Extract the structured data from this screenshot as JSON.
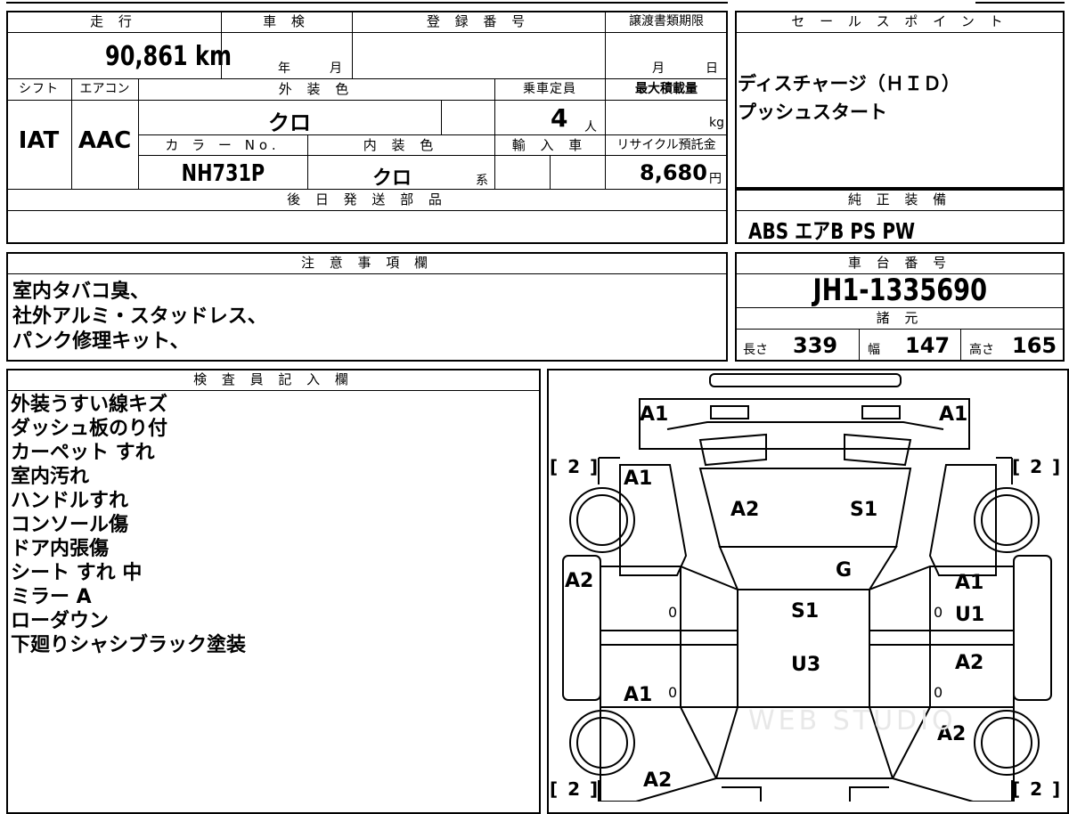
{
  "main_table": {
    "mileage_header": "走 行",
    "inspection_header": "車 検",
    "registration_header": "登 録 番 号",
    "transfer_header": "譲渡書類期限",
    "mileage_value": "90,861",
    "mileage_unit": "km",
    "inspection_year_unit": "年",
    "inspection_month_unit": "月",
    "transfer_month_unit": "月",
    "transfer_day_unit": "日",
    "shift_header": "シフト",
    "aircon_header": "エアコン",
    "exterior_color_header": "外 装 色",
    "capacity_header": "乗車定員",
    "max_load_header": "最大積載量",
    "shift_value": "IAT",
    "aircon_value": "AAC",
    "exterior_color_value": "クロ",
    "capacity_value": "4",
    "capacity_unit": "人",
    "max_load_unit": "kg",
    "color_no_header": "カ ラ ー No.",
    "interior_color_header": "内 装 色",
    "import_header": "輸 入 車",
    "recycle_header": "リサイクル預託金",
    "color_no_value": "NH731P",
    "interior_color_value": "クロ",
    "interior_color_suffix": "系",
    "recycle_value": "8,680",
    "recycle_unit": "円",
    "later_parts_header": "後 日 発 送 部 品"
  },
  "sales_points": {
    "header": "セ ー ル ス ポ イ ン ト",
    "lines": [
      "ディスチャージ（ＨＩＤ）",
      "プッシュスタート"
    ]
  },
  "standard_equipment": {
    "header": "純 正 装 備",
    "value": "ABS エアB PS PW"
  },
  "notes": {
    "header": "注 意 事 項 欄",
    "lines": [
      "室内タバコ臭、",
      "社外アルミ・スタッドレス、",
      "パンク修理キット、"
    ]
  },
  "chassis": {
    "header": "車 台 番 号",
    "value": "JH1-1335690",
    "specs_header": "諸 元",
    "length_label": "長さ",
    "length_value": "339",
    "width_label": "幅",
    "width_value": "147",
    "height_label": "高さ",
    "height_value": "165"
  },
  "inspector": {
    "header": "検 査 員 記 入 欄",
    "lines": [
      "外装うすい線キズ",
      "ダッシュ板のり付",
      "カーペット すれ",
      "室内汚れ",
      "ハンドルすれ",
      "コンソール傷",
      "ドア内張傷",
      "シート すれ 中",
      "ミラー A",
      "ローダウン",
      "下廻りシャシブラック塗装"
    ]
  },
  "diagram": {
    "marks": {
      "front_left": "A1",
      "front_right": "A1",
      "fender_left": "A1",
      "hood_left": "A2",
      "hood_right": "S1",
      "glass": "G",
      "door_front_left": "A2",
      "door_front_right": "A1",
      "door_front_right2": "U1",
      "roof": "S1",
      "door_rear_right": "A2",
      "rear": "U3",
      "door_rear_left": "A1",
      "quarter_right": "A2",
      "back_left": "A2"
    },
    "tire_counts": {
      "front_left": "[ 2 ]",
      "front_right": "[ 2 ]",
      "rear_left": "[ 2 ]",
      "rear_right": "[ 2 ]"
    },
    "zeros": [
      "0",
      "0",
      "0",
      "0"
    ],
    "watermark": "WEB STUDIO"
  }
}
